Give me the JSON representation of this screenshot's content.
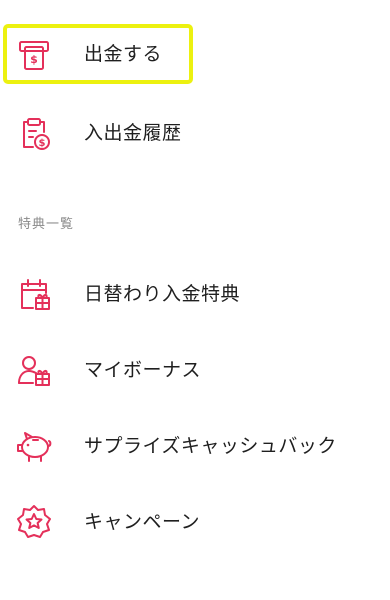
{
  "account_menu": {
    "items": [
      {
        "label": "出金する",
        "icon": "withdraw-icon",
        "highlighted": true
      },
      {
        "label": "入出金履歴",
        "icon": "history-icon"
      }
    ]
  },
  "benefits_section": {
    "title": "特典一覧",
    "items": [
      {
        "label": "日替わり入金特典",
        "icon": "calendar-gift-icon"
      },
      {
        "label": "マイボーナス",
        "icon": "user-gift-icon"
      },
      {
        "label": "サプライズキャッシュバック",
        "icon": "piggy-bank-icon"
      },
      {
        "label": "キャンペーン",
        "icon": "badge-star-icon"
      }
    ]
  },
  "colors": {
    "accent": "#e4305a",
    "highlight": "#ecf110",
    "section_text": "#8a8a8a"
  }
}
